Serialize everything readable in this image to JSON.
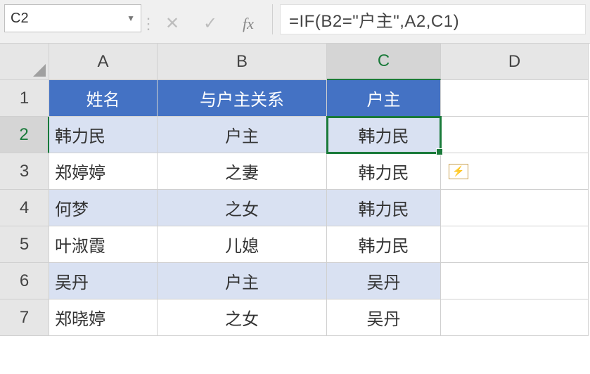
{
  "name_box": "C2",
  "formula": "=IF(B2=\"户主\",A2,C1)",
  "columns": [
    "A",
    "B",
    "C",
    "D"
  ],
  "rows": [
    "1",
    "2",
    "3",
    "4",
    "5",
    "6",
    "7"
  ],
  "headers": {
    "A": "姓名",
    "B": "与户主关系",
    "C": "户主"
  },
  "data": [
    {
      "A": "韩力民",
      "B": "户主",
      "C": "韩力民"
    },
    {
      "A": "郑婷婷",
      "B": "之妻",
      "C": "韩力民"
    },
    {
      "A": "何梦",
      "B": "之女",
      "C": "韩力民"
    },
    {
      "A": "叶淑霞",
      "B": "儿媳",
      "C": "韩力民"
    },
    {
      "A": "吴丹",
      "B": "户主",
      "C": "吴丹"
    },
    {
      "A": "郑晓婷",
      "B": "之女",
      "C": "吴丹"
    }
  ],
  "active": {
    "col": "C",
    "row": 2
  },
  "fx_label": "fx"
}
